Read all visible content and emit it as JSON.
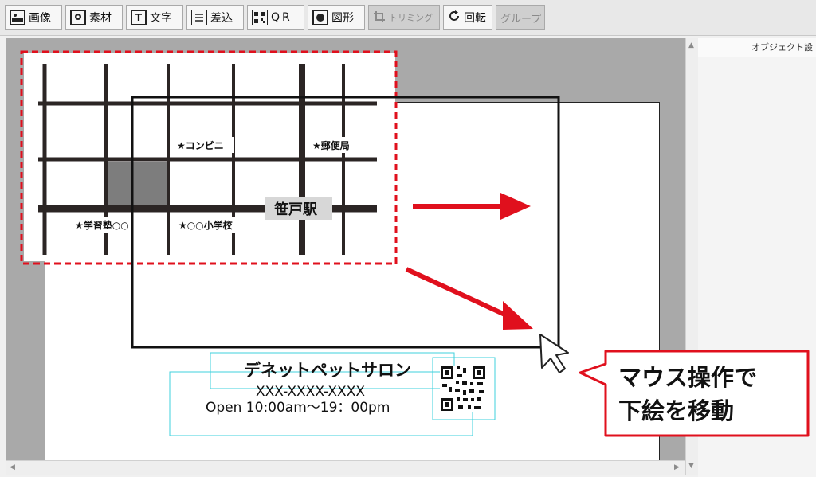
{
  "toolbar": {
    "buttons": [
      {
        "label": "画像",
        "icon": "image-icon"
      },
      {
        "label": "素材",
        "icon": "material-icon"
      },
      {
        "label": "文字",
        "icon": "text-icon",
        "glyph": "T"
      },
      {
        "label": "差込",
        "icon": "merge-icon"
      },
      {
        "label": "QR",
        "icon": "qr-icon"
      },
      {
        "label": "図形",
        "icon": "shape-icon"
      },
      {
        "label": "トリミング",
        "icon": "crop-icon",
        "disabled": true
      },
      {
        "label": "回転",
        "icon": "rotate-icon"
      },
      {
        "label": "グループ",
        "icon": "",
        "disabled": true
      }
    ]
  },
  "right_panel": {
    "title": "オブジェクト設"
  },
  "map": {
    "labels": {
      "convenience": "★コンビニ",
      "post_office": "★郵便局",
      "station": "笹戸駅",
      "cram_school": "★学習塾○○",
      "elementary": "★○○小学校"
    }
  },
  "card": {
    "name": "デネットペットサロン",
    "phone": "XXX-XXXX-XXXX",
    "hours": "Open 10:00am～19：00pm"
  },
  "callout": {
    "line1": "マウス操作で",
    "line2": "下絵を移動"
  },
  "colors": {
    "accent_red": "#e0101d",
    "selection_cyan": "#3fd0dc",
    "map_road": "#2b2524"
  }
}
